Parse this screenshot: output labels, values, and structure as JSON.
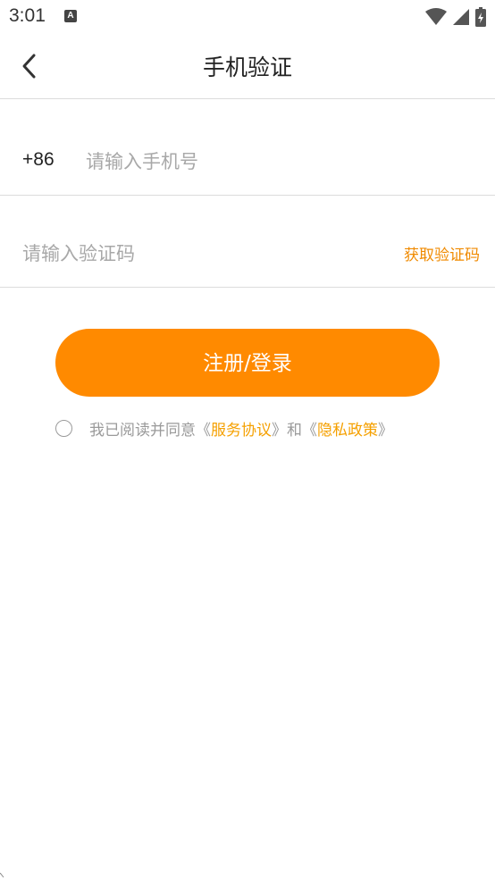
{
  "status_bar": {
    "time": "3:01",
    "app_icon_label": "A",
    "icons": [
      "wifi-icon",
      "signal-icon",
      "battery-icon"
    ]
  },
  "header": {
    "title": "手机验证",
    "back_icon": "chevron-left-icon"
  },
  "phone": {
    "country_code": "+86",
    "placeholder": "请输入手机号",
    "value": ""
  },
  "code": {
    "placeholder": "请输入验证码",
    "value": "",
    "get_code_label": "获取验证码"
  },
  "submit_label": "注册/登录",
  "agreement": {
    "checked": false,
    "prefix": "我已阅读并同意《",
    "service_link": "服务协议",
    "middle": "》和《",
    "privacy_link": "隐私政策",
    "suffix": "》"
  },
  "colors": {
    "accent": "#ff8a00",
    "link": "#f5a000",
    "get_code": "#f08a00",
    "placeholder": "#a8a8a8",
    "divider": "#dcdcdc"
  }
}
